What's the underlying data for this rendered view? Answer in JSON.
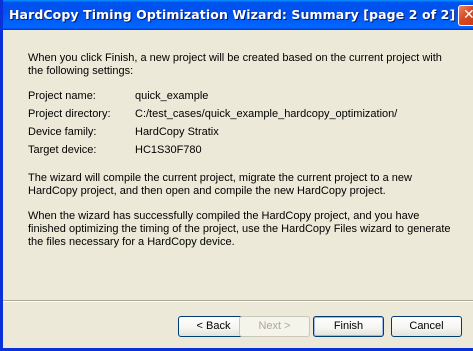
{
  "window": {
    "title": "HardCopy Timing Optimization Wizard: Summary [page 2 of 2]",
    "close_symbol": "✕"
  },
  "intro": "When you click Finish, a new project will be created based on the current project with the following settings:",
  "settings": [
    {
      "label": "Project name:",
      "value": "quick_example"
    },
    {
      "label": "Project directory:",
      "value": "C:/test_cases/quick_example_hardcopy_optimization/"
    },
    {
      "label": "Device family:",
      "value": "HardCopy Stratix"
    },
    {
      "label": "Target device:",
      "value": "HC1S30F780"
    }
  ],
  "paragraph_compile": "The wizard will compile the current project, migrate the current project to a new HardCopy project, and then open and compile the new HardCopy project.",
  "paragraph_files": "When the wizard has successfully compiled the HardCopy project, and you have finished optimizing the timing of the project, use the HardCopy Files wizard to generate the files necessary for a HardCopy device.",
  "buttons": {
    "back": "< Back",
    "next": "Next >",
    "finish": "Finish",
    "cancel": "Cancel"
  },
  "colors": {
    "titlebar": "#0050ee",
    "dialog_bg": "#ece9d8",
    "close_button": "#d8481f"
  },
  "icons": {
    "close": "close-icon"
  }
}
